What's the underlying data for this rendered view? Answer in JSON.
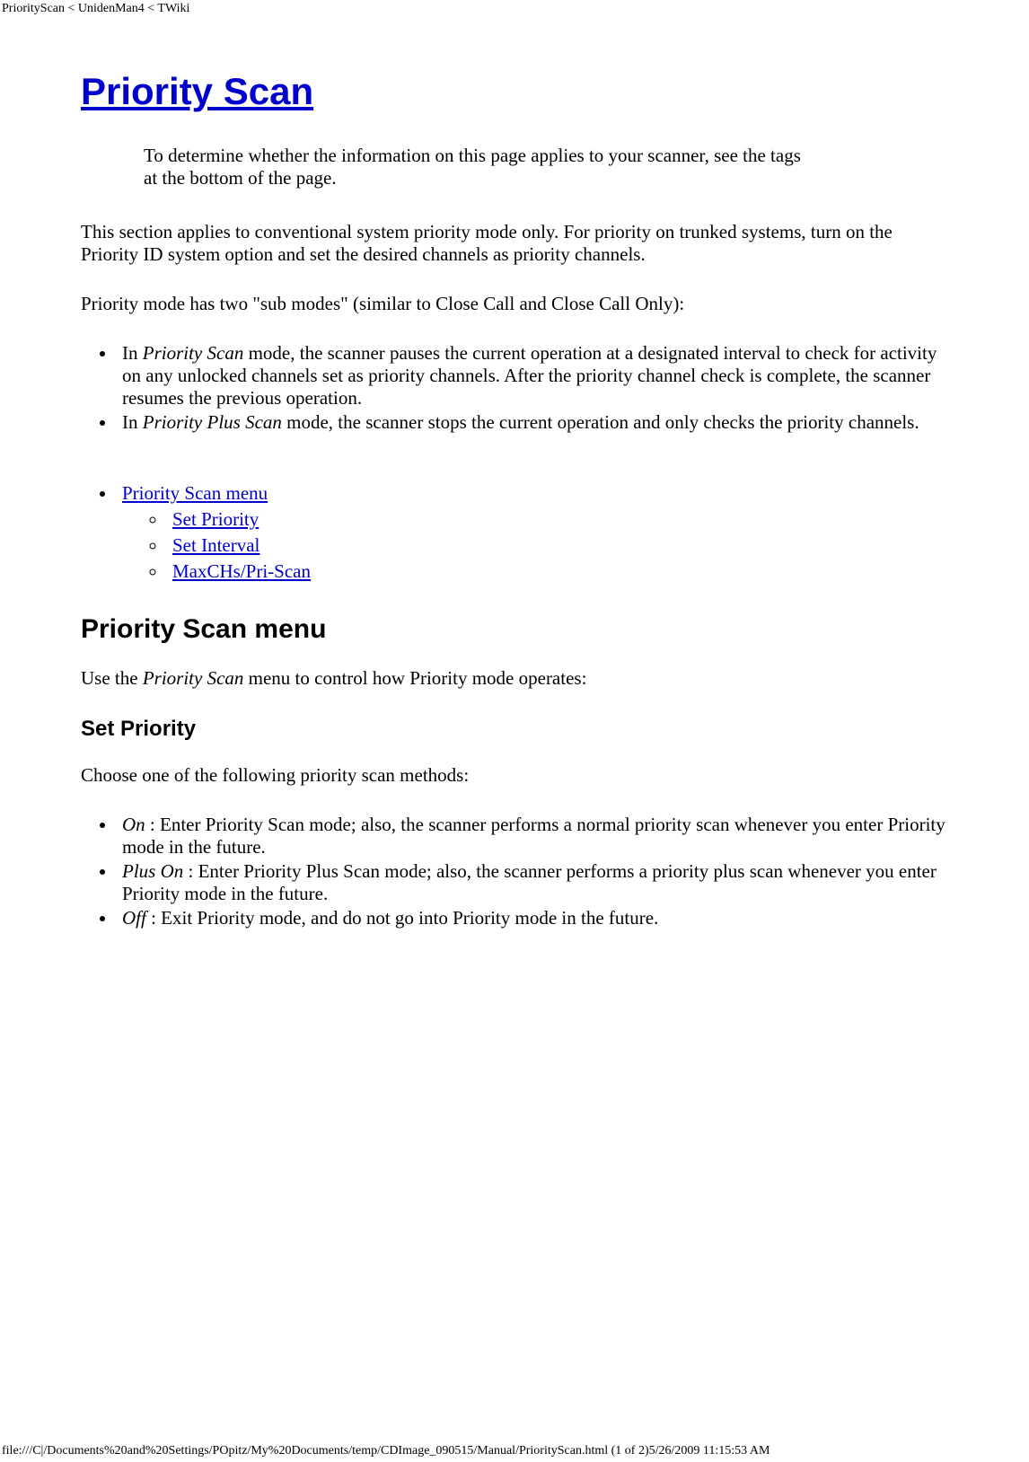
{
  "headerTag": "PriorityScan < UnidenMan4 < TWiki",
  "title": "Priority Scan",
  "intro": "To determine whether the information on this page applies to your scanner, see the tags at the bottom of the page.",
  "para1": "This section applies to conventional system priority mode only. For priority on trunked systems, turn on the Priority ID system option and set the desired channels as priority channels.",
  "para2": "Priority mode has two \"sub modes\" (similar to Close Call and Close Call Only):",
  "modes": {
    "scan": {
      "em": "Priority Scan",
      "before": "In ",
      "after": " mode, the scanner pauses the current operation at a designated interval to check for activity on any unlocked channels set as priority channels. After the priority channel check is complete, the scanner resumes the previous operation."
    },
    "plus": {
      "em": "Priority Plus Scan",
      "before": "In ",
      "after": " mode, the scanner stops the current operation and only checks the priority channels."
    }
  },
  "toc": {
    "main": "Priority Scan menu",
    "sub": [
      "Set Priority",
      "Set Interval",
      "MaxCHs/Pri-Scan"
    ]
  },
  "h2": "Priority Scan menu",
  "usePara": {
    "before": "Use the ",
    "em": "Priority Scan",
    "after": " menu to control how Priority mode operates:"
  },
  "h3": "Set Priority",
  "choosePara": "Choose one of the following priority scan methods:",
  "methods": {
    "on": {
      "em": "On",
      "rest": " : Enter Priority Scan mode; also, the scanner performs a normal priority scan whenever you enter Priority mode in the future."
    },
    "plusOn": {
      "em": "Plus On",
      "rest": " : Enter Priority Plus Scan mode; also, the scanner performs a priority plus scan whenever you enter Priority mode in the future."
    },
    "off": {
      "em": "Off",
      "rest": " : Exit Priority mode, and do not go into Priority mode in the future."
    }
  },
  "footer": "file:///C|/Documents%20and%20Settings/POpitz/My%20Documents/temp/CDImage_090515/Manual/PriorityScan.html (1 of 2)5/26/2009 11:15:53 AM"
}
